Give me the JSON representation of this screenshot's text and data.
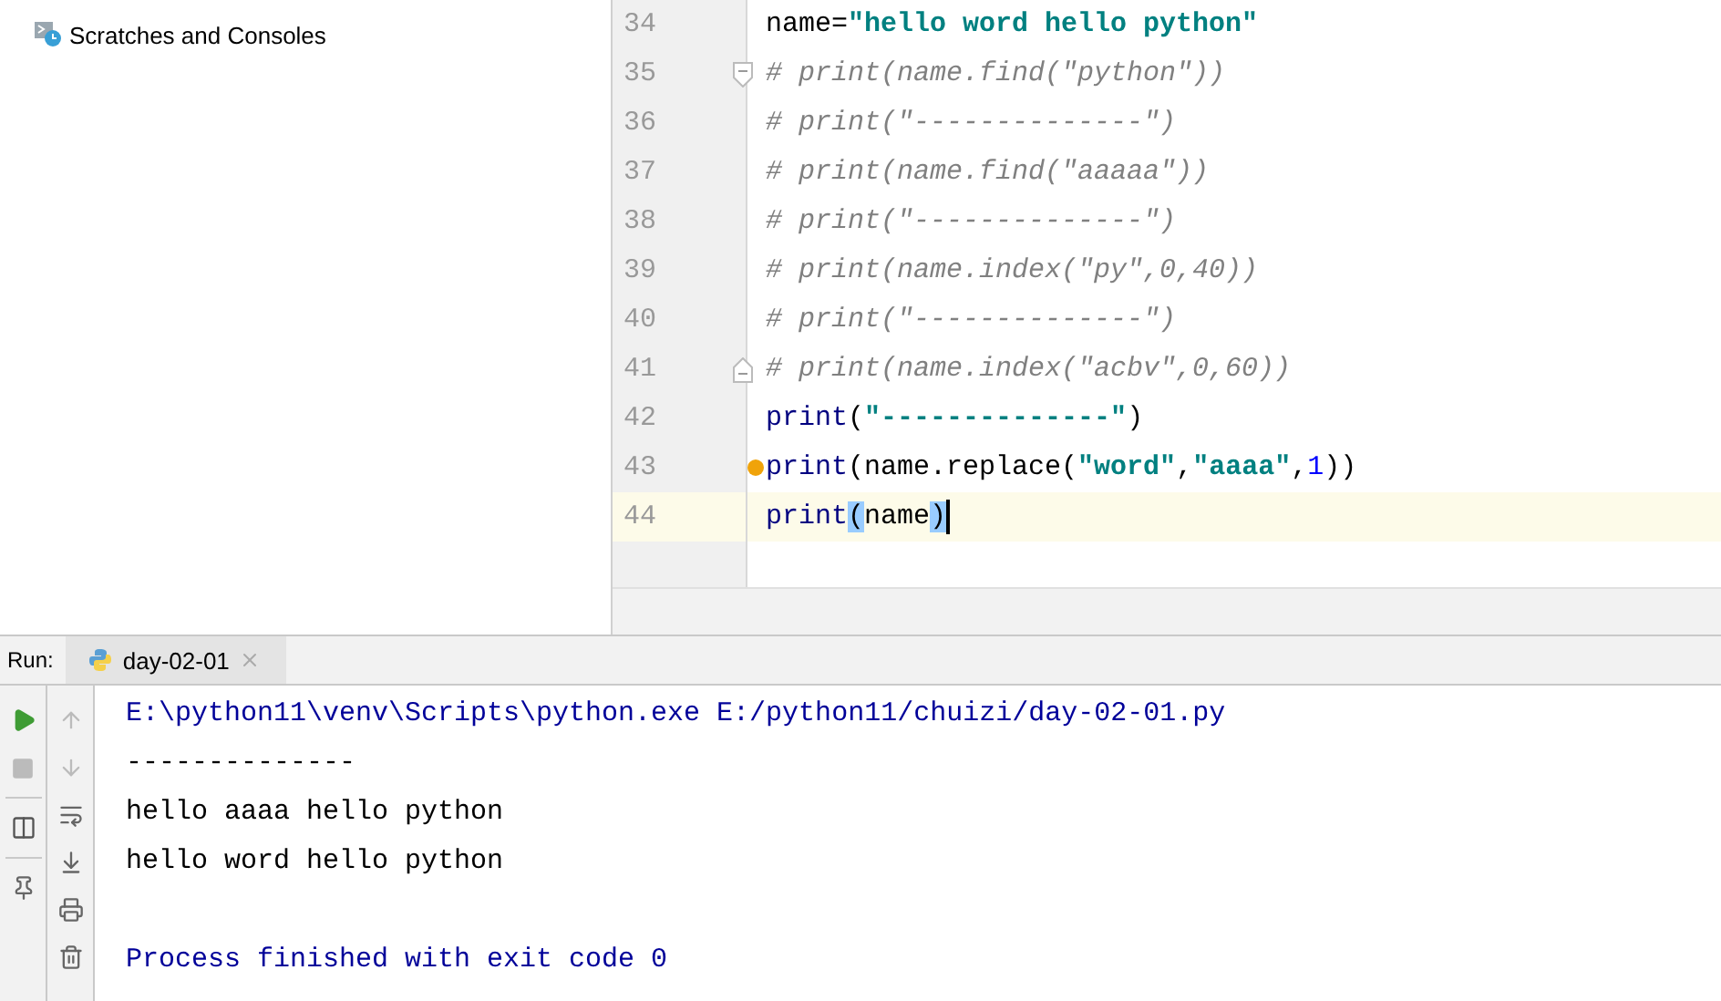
{
  "project_tree": {
    "items": [
      {
        "label": "Scratches and Consoles"
      }
    ]
  },
  "editor": {
    "lines": [
      {
        "number": "34",
        "current": false,
        "tokens": [
          {
            "kind": "text",
            "text": "name="
          },
          {
            "kind": "string",
            "text": "\"hello word hello python\""
          }
        ]
      },
      {
        "number": "35",
        "current": false,
        "fold_start": true,
        "tokens": [
          {
            "kind": "comment",
            "text": "# print(name.find(\"python\"))"
          }
        ]
      },
      {
        "number": "36",
        "current": false,
        "tokens": [
          {
            "kind": "comment",
            "text": "# print(\"--------------\")"
          }
        ]
      },
      {
        "number": "37",
        "current": false,
        "tokens": [
          {
            "kind": "comment",
            "text": "# print(name.find(\"aaaaa\"))"
          }
        ]
      },
      {
        "number": "38",
        "current": false,
        "tokens": [
          {
            "kind": "comment",
            "text": "# print(\"--------------\")"
          }
        ]
      },
      {
        "number": "39",
        "current": false,
        "tokens": [
          {
            "kind": "comment",
            "text": "# print(name.index(\"py\",0,40))"
          }
        ]
      },
      {
        "number": "40",
        "current": false,
        "tokens": [
          {
            "kind": "comment",
            "text": "# print(\"--------------\")"
          }
        ]
      },
      {
        "number": "41",
        "current": false,
        "fold_end": true,
        "tokens": [
          {
            "kind": "comment",
            "text": "# print(name.index(\"acbv\",0,60))"
          }
        ]
      },
      {
        "number": "42",
        "current": false,
        "tokens": [
          {
            "kind": "builtin",
            "text": "print"
          },
          {
            "kind": "text",
            "text": "("
          },
          {
            "kind": "string",
            "text": "\"--------------\""
          },
          {
            "kind": "text",
            "text": ")"
          }
        ]
      },
      {
        "number": "43",
        "current": false,
        "bulb": true,
        "tokens": [
          {
            "kind": "builtin",
            "text": "print"
          },
          {
            "kind": "text",
            "text": "(name.replace("
          },
          {
            "kind": "string",
            "text": "\"word\""
          },
          {
            "kind": "text",
            "text": ","
          },
          {
            "kind": "string",
            "text": "\"aaaa\""
          },
          {
            "kind": "text",
            "text": ","
          },
          {
            "kind": "number",
            "text": "1"
          },
          {
            "kind": "text",
            "text": "))"
          }
        ]
      },
      {
        "number": "44",
        "current": true,
        "tokens": [
          {
            "kind": "builtin",
            "text": "print"
          },
          {
            "kind": "match",
            "text": "("
          },
          {
            "kind": "text",
            "text": "name"
          },
          {
            "kind": "match",
            "text": ")"
          }
        ]
      }
    ]
  },
  "run_panel": {
    "label": "Run:",
    "tabs": [
      {
        "label": "day-02-01",
        "selected": true
      }
    ],
    "output": [
      {
        "kind": "system",
        "text": "E:\\python11\\venv\\Scripts\\python.exe E:/python11/chuizi/day-02-01.py"
      },
      {
        "kind": "stdout",
        "text": "--------------"
      },
      {
        "kind": "stdout",
        "text": "hello aaaa hello python"
      },
      {
        "kind": "stdout",
        "text": "hello word hello python"
      },
      {
        "kind": "exit",
        "text": "Process finished with exit code 0"
      }
    ]
  }
}
